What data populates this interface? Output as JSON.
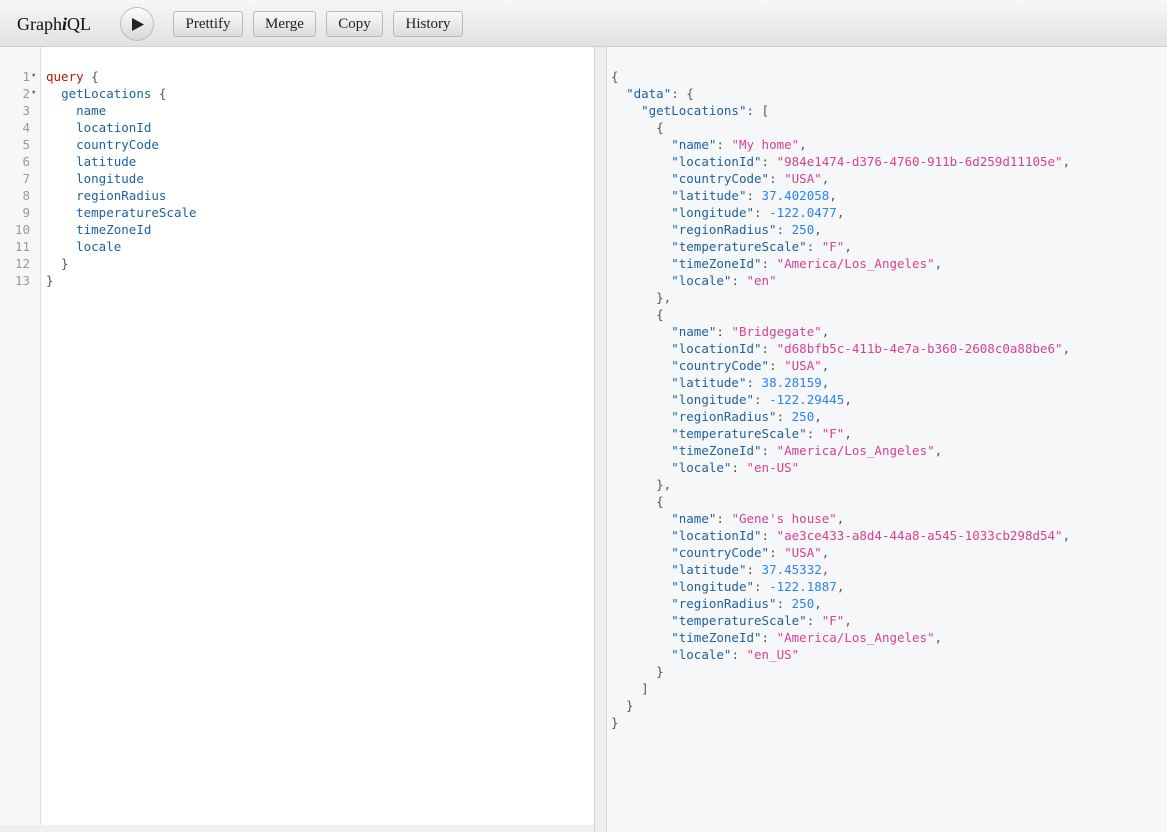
{
  "app": {
    "title_prefix": "Graph",
    "title_italic": "i",
    "title_suffix": "QL"
  },
  "toolbar": {
    "run_icon": "play-icon",
    "prettify_label": "Prettify",
    "merge_label": "Merge",
    "copy_label": "Copy",
    "history_label": "History"
  },
  "query": {
    "keyword": "query",
    "operation": "getLocations",
    "fields": [
      "name",
      "locationId",
      "countryCode",
      "latitude",
      "longitude",
      "regionRadius",
      "temperatureScale",
      "timeZoneId",
      "locale"
    ],
    "line_numbers": [
      "1",
      "2",
      "3",
      "4",
      "5",
      "6",
      "7",
      "8",
      "9",
      "10",
      "11",
      "12",
      "13"
    ]
  },
  "result": {
    "data_key": "data",
    "list_key": "getLocations",
    "items": [
      {
        "name": "My home",
        "locationId": "984e1474-d376-4760-911b-6d259d11105e",
        "countryCode": "USA",
        "latitude": 37.402058,
        "longitude": -122.0477,
        "regionRadius": 250,
        "temperatureScale": "F",
        "timeZoneId": "America/Los_Angeles",
        "locale": "en"
      },
      {
        "name": "Bridgegate",
        "locationId": "d68bfb5c-411b-4e7a-b360-2608c0a88be6",
        "countryCode": "USA",
        "latitude": 38.28159,
        "longitude": -122.29445,
        "regionRadius": 250,
        "temperatureScale": "F",
        "timeZoneId": "America/Los_Angeles",
        "locale": "en-US"
      },
      {
        "name": "Gene's house",
        "locationId": "ae3ce433-a8d4-44a8-a545-1033cb298d54",
        "countryCode": "USA",
        "latitude": 37.45332,
        "longitude": -122.1887,
        "regionRadius": 250,
        "temperatureScale": "F",
        "timeZoneId": "America/Los_Angeles",
        "locale": "en_US"
      }
    ]
  },
  "colors": {
    "keyword": "#b11a04",
    "field": "#1f61a0",
    "string": "#d64292",
    "number": "#2882f9"
  }
}
